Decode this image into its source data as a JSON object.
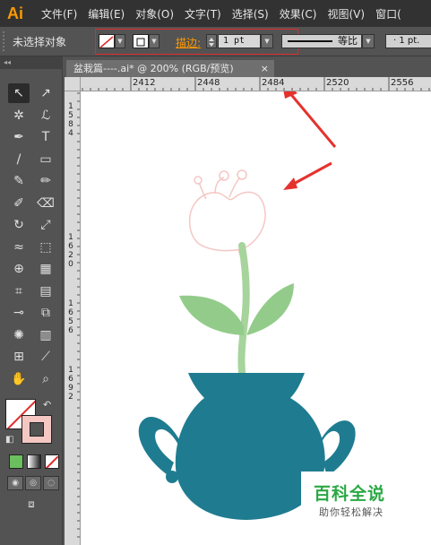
{
  "app": {
    "logo": "Ai",
    "menu": [
      "文件(F)",
      "编辑(E)",
      "对象(O)",
      "文字(T)",
      "选择(S)",
      "效果(C)",
      "视图(V)",
      "窗口("
    ]
  },
  "control_bar": {
    "selection_status": "未选择对象",
    "stroke_label": "描边:",
    "stroke_weight": "1 pt",
    "profile_label": "等比",
    "brush_width": "· 1 pt."
  },
  "toolbar": {
    "collapse_glyph": "◂◂",
    "tools": [
      {
        "name": "selection-tool",
        "glyph": "↖"
      },
      {
        "name": "direct-selection-tool",
        "glyph": "↗"
      },
      {
        "name": "magic-wand-tool",
        "glyph": "✲"
      },
      {
        "name": "lasso-tool",
        "glyph": "ℒ"
      },
      {
        "name": "pen-tool",
        "glyph": "✒"
      },
      {
        "name": "type-tool",
        "glyph": "T"
      },
      {
        "name": "line-tool",
        "glyph": "/"
      },
      {
        "name": "rectangle-tool",
        "glyph": "▭"
      },
      {
        "name": "paintbrush-tool",
        "glyph": "✎"
      },
      {
        "name": "pencil-tool",
        "glyph": "✏"
      },
      {
        "name": "blob-brush-tool",
        "glyph": "✐"
      },
      {
        "name": "eraser-tool",
        "glyph": "⌫"
      },
      {
        "name": "rotate-tool",
        "glyph": "↻"
      },
      {
        "name": "scale-tool",
        "glyph": "⤢"
      },
      {
        "name": "warp-tool",
        "glyph": "≈"
      },
      {
        "name": "free-transform-tool",
        "glyph": "⬚"
      },
      {
        "name": "shape-builder-tool",
        "glyph": "⊕"
      },
      {
        "name": "perspective-grid-tool",
        "glyph": "▦"
      },
      {
        "name": "mesh-tool",
        "glyph": "⌗"
      },
      {
        "name": "gradient-tool",
        "glyph": "▤"
      },
      {
        "name": "eyedropper-tool",
        "glyph": "⊸"
      },
      {
        "name": "blend-tool",
        "glyph": "⧉"
      },
      {
        "name": "symbol-sprayer-tool",
        "glyph": "✺"
      },
      {
        "name": "column-graph-tool",
        "glyph": "▥"
      },
      {
        "name": "artboard-tool",
        "glyph": "⊞"
      },
      {
        "name": "slice-tool",
        "glyph": "⟋"
      },
      {
        "name": "hand-tool",
        "glyph": "✋"
      },
      {
        "name": "zoom-tool",
        "glyph": "⌕"
      }
    ],
    "swap_glyph": "↶",
    "default_glyph": "◧",
    "screen_mode_glyph": "⧈"
  },
  "document": {
    "tab_title": "盆栽篇----.ai* @ 200% (RGB/预览)",
    "close_glyph": "×",
    "h_ruler": [
      "2412",
      "2448",
      "2484",
      "2520",
      "2556"
    ],
    "v_ruler": [
      "1584",
      "1620",
      "1656",
      "1692"
    ]
  },
  "colors": {
    "vase": "#1f7c90",
    "leaf": "#93cc8a",
    "stem": "#a6d49c",
    "flower_outline": "#f4c7c3",
    "arrow": "#e5322d",
    "accent": "#ff9a00"
  },
  "watermark": {
    "title": "百科全说",
    "subtitle": "助你轻松解决"
  }
}
